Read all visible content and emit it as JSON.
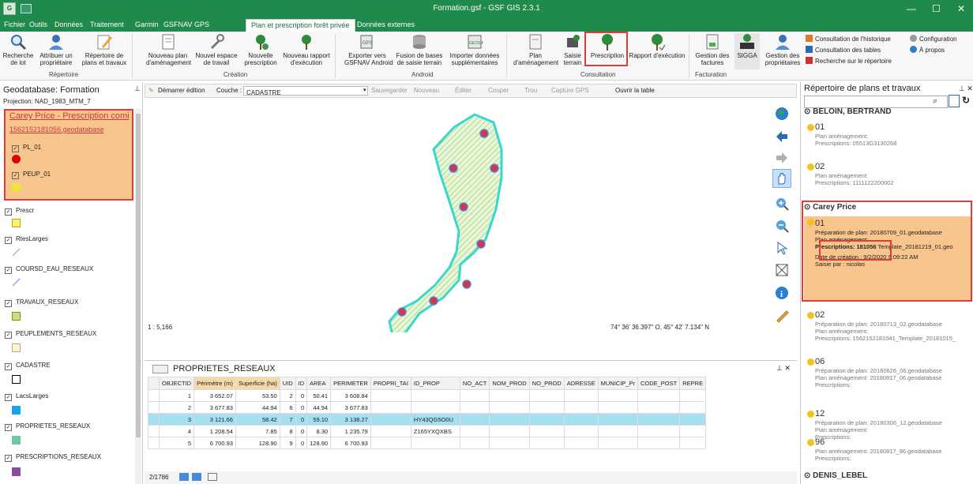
{
  "window": {
    "title": "Formation.gsf - GSF GIS 2.3.1",
    "app_icon": "G",
    "minimize": "—",
    "maximize": "☐",
    "close": "✕"
  },
  "menu": [
    "Fichier",
    "Outils",
    "Données",
    "Traitement",
    "Garmin",
    "GSFNAV",
    "GPS",
    "Plan et prescription forêt privée",
    "Données externes"
  ],
  "ribbon": {
    "buttons": [
      {
        "label": "Recherche\nde lot",
        "icon": "search-icon"
      },
      {
        "label": "Attribuer un\npropriétaire",
        "icon": "user-icon"
      },
      {
        "label": "Répertoire de\nplans et travaux",
        "icon": "pencil-icon"
      },
      {
        "label": "Nouveau plan\nd'aménagement",
        "icon": "plan-icon"
      },
      {
        "label": "Nouvel espace\nde travail",
        "icon": "tools-icon"
      },
      {
        "label": "Nouvelle\nprescription",
        "icon": "tree-add-icon"
      },
      {
        "label": "Nouveau rapport\nd'exécution",
        "icon": "tree-report-icon"
      },
      {
        "label": "Exporter vers\nGSFNAV Android",
        "icon": "export-icon"
      },
      {
        "label": "Fusion de bases\nde saisie terrain",
        "icon": "database-icon"
      },
      {
        "label": "Importer données\nsupplémentaires",
        "icon": "import-icon"
      },
      {
        "label": "Plan\nd'aménagement",
        "icon": "document-icon"
      },
      {
        "label": "Saisie\nterrain",
        "icon": "field-icon"
      },
      {
        "label": "Prescription",
        "icon": "tree-icon"
      },
      {
        "label": "Rapport d'exécution",
        "icon": "tree-check-icon"
      },
      {
        "label": "Gestion des\nfactures",
        "icon": "invoice-icon"
      },
      {
        "label": "SIGGA",
        "icon": "sigga-icon"
      },
      {
        "label": "Gestion des\npropriétaires",
        "icon": "owners-icon"
      }
    ],
    "groups": [
      "Répertoire",
      "Création",
      "Android",
      "Consultation",
      "Facturation"
    ],
    "small": [
      "Consultation de l'historique",
      "Consultation des tables",
      "Recherche sur le répertoire",
      "Configuration",
      "À propos"
    ]
  },
  "left": {
    "title": "Geodatabase: Formation",
    "projection": "Projection: NAD_1983_MTM_7",
    "project_title": "Carey Price - Prescription comi",
    "project_db": "1562152181056.geodatabase",
    "layers": [
      {
        "name": "PL_01",
        "color": "#e00000"
      },
      {
        "name": "PEUP_01",
        "color": "#f0e040"
      },
      {
        "name": "Prescr",
        "color": "#f5f27a"
      },
      {
        "name": "RtesLarges",
        "color": "#c090d0"
      },
      {
        "name": "COURSD_EAU_RESEAUX",
        "color": "#8090e0"
      },
      {
        "name": "TRAVAUX_RESEAUX",
        "color": "#c8e08c"
      },
      {
        "name": "PEUPLEMENTS_RESEAUX",
        "color": "#fdf5c0"
      },
      {
        "name": "CADASTRE",
        "color": "#ffffff"
      },
      {
        "name": "LacsLarges",
        "color": "#1aa3e8"
      },
      {
        "name": "PROPRIETES_RESEAUX",
        "color": "#6fc9a0"
      },
      {
        "name": "PRESCRIPTIONS_RESEAUX",
        "color": "#8a4ea0"
      }
    ]
  },
  "maptoolbar": {
    "start": "Démarrer édition",
    "layer_label": "Couche :",
    "layer": "CADASTRE",
    "save": "Sauvegarder",
    "new": "Nouveau",
    "edit": "Éditer",
    "cut": "Couper",
    "hole": "Trou",
    "gps": "Capture GPS",
    "open_table": "Ouvrir la table"
  },
  "map": {
    "scale": "1 : 5,166",
    "coords": "74° 36' 36.397\" O, 45° 42' 7.134\" N"
  },
  "table": {
    "title": "PROPRIETES_RESEAUX",
    "columns": [
      "OBJECTID",
      "Périmètre (m)",
      "Superficie (ha)",
      "UID",
      "ID",
      "AREA",
      "PERIMETER",
      "PROPRI_TAI",
      "ID_PROP",
      "NO_ACT",
      "NOM_PROD",
      "NO_PROD",
      "ADRESSE",
      "MUNICIP_Pr",
      "CODE_POST",
      "REPRE"
    ],
    "rows": [
      [
        "1",
        "3 652.07",
        "53.50",
        "2",
        "0",
        "50.41",
        "3 608.84",
        "",
        ""
      ],
      [
        "2",
        "3 677.83",
        "44.94",
        "6",
        "0",
        "44.94",
        "3 677.83",
        "",
        ""
      ],
      [
        "3",
        "3 121.66",
        "58.42",
        "7",
        "0",
        "59.10",
        "3 138.27",
        "",
        "HY43QG5O0U"
      ],
      [
        "4",
        "1 208.54",
        "7.85",
        "8",
        "0",
        "8.30",
        "1 235.79",
        "",
        "Z165YXQXBS"
      ],
      [
        "5",
        "6 700.93",
        "128.90",
        "9",
        "0",
        "128.90",
        "6 700.93",
        "",
        ""
      ]
    ],
    "footer": "2/1786"
  },
  "right": {
    "title": "Répertoire de plans et travaux",
    "groups": [
      "BELOIN, BERTRAND",
      "Carey Price",
      "DENIS_LEBEL"
    ],
    "items": [
      {
        "num": "01",
        "l1": "Plan aménagement:",
        "l2": "Prescriptions: 05513G3130268"
      },
      {
        "num": "02",
        "l1": "Plan aménagement:",
        "l2": "Prescriptions: 1111122200002"
      },
      {
        "num": "01",
        "l0": "Préparation de plan: 20180709_01.geodatabase",
        "l1": "Plan aménagement:",
        "l2a": "Prescriptions: 181056",
        "l2b": "Template_20181219_01.geo",
        "l3": "Date de création : 9/2/2020 9:09:22 AM",
        "l4": "Saisie par : nicolas"
      },
      {
        "num": "02",
        "l0": "Préparation de plan: 20180713_02.geodatabase",
        "l1": "Plan aménagement:",
        "l2": "Prescriptions: 1562152181041_Template_20181015_"
      },
      {
        "num": "06",
        "l0": "Préparation de plan: 20180626_06.geodatabase",
        "l1": "Plan aménagement: 20180817_06.geodatabase",
        "l2": "Prescriptions:"
      },
      {
        "num": "12",
        "l0": "Préparation de plan: 20180306_12.geodatabase",
        "l1": "Plan aménagement:",
        "l2": "Prescriptions:"
      },
      {
        "num": "96",
        "l1": "Plan aménagement: 20180817_96.geodatabase",
        "l2": "Prescriptions:"
      }
    ]
  },
  "colors": {
    "accent": "#1f8a4c",
    "highlight": "#f8c58d",
    "polygon": "#37d8cf",
    "point": "#d9324a",
    "selection": "#a6dff0",
    "annotation": "#e03b3b"
  }
}
